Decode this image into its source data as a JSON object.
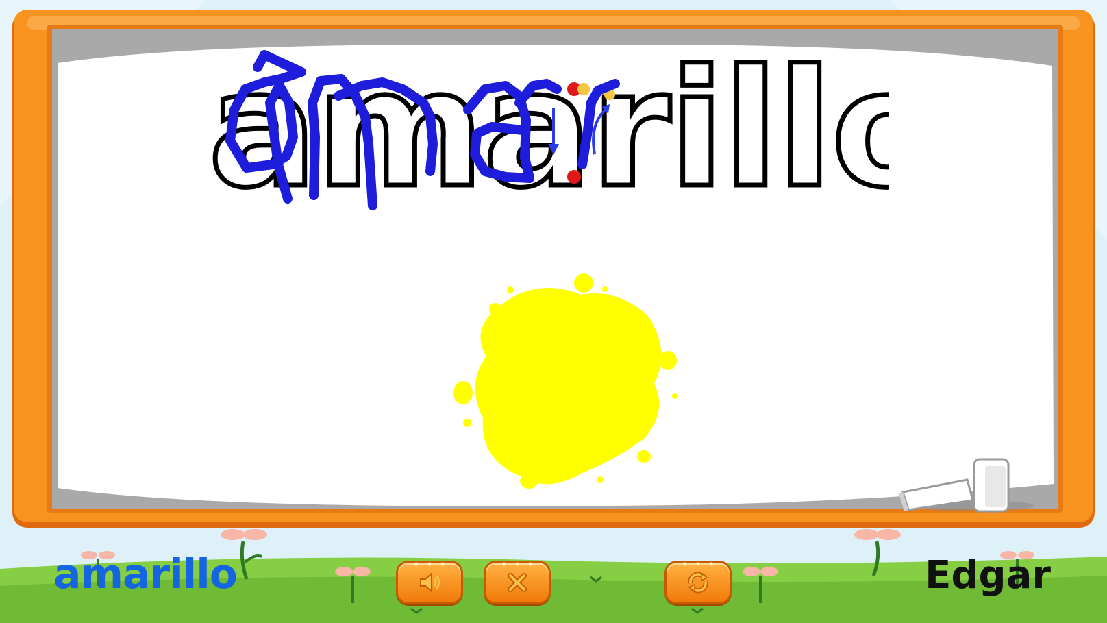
{
  "game": {
    "target_word": "amarillo",
    "bottom_label": "amarillo",
    "player_name": "Edgar",
    "color_name": "amarillo"
  },
  "controls": {
    "sound_icon": "speaker-icon",
    "close_icon": "close-x-icon",
    "replay_icon": "replay-icon"
  },
  "colors": {
    "board_frame": "#f7931e",
    "board_frame_dark": "#e06a10",
    "board_inner_border": "#a9a9a9",
    "board_surface": "#ffffff",
    "blob_color": "#ffff00",
    "drawing_stroke": "#1d1ddb",
    "bottom_label": "#1565e0",
    "player_name": "#111111",
    "button_fill": "#f58a1a",
    "grass": "#7cc63f",
    "sky": "#dff1f8"
  }
}
